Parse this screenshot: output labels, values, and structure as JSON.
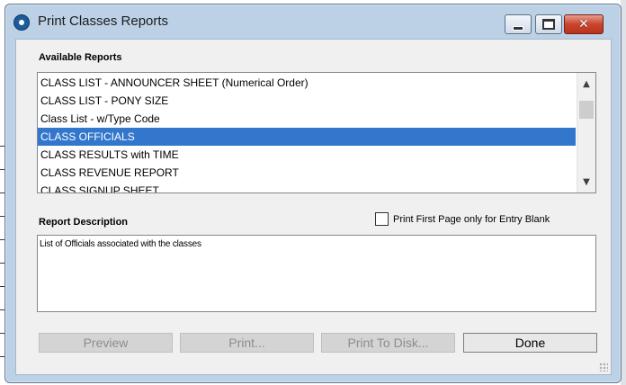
{
  "window": {
    "title": "Print Classes Reports"
  },
  "reports": {
    "label": "Available Reports",
    "items": [
      "CLASS LIST - ANNOUNCER SHEET (Numerical Order)",
      "CLASS LIST - PONY SIZE",
      "Class List - w/Type Code",
      "CLASS OFFICIALS",
      "CLASS RESULTS with TIME",
      "CLASS REVENUE REPORT",
      "CLASS SIGNUP SHEET"
    ],
    "selected_index": 3
  },
  "options": {
    "print_first_page_label": "Print First Page only for Entry Blank",
    "print_first_page_checked": false
  },
  "description": {
    "label": "Report Description",
    "text": "List of Officials associated with the classes"
  },
  "buttons": {
    "preview": "Preview",
    "print": "Print...",
    "print_to_disk": "Print To Disk...",
    "done": "Done"
  },
  "colors": {
    "selection": "#3377cc",
    "frame": "#bcd0e6"
  }
}
